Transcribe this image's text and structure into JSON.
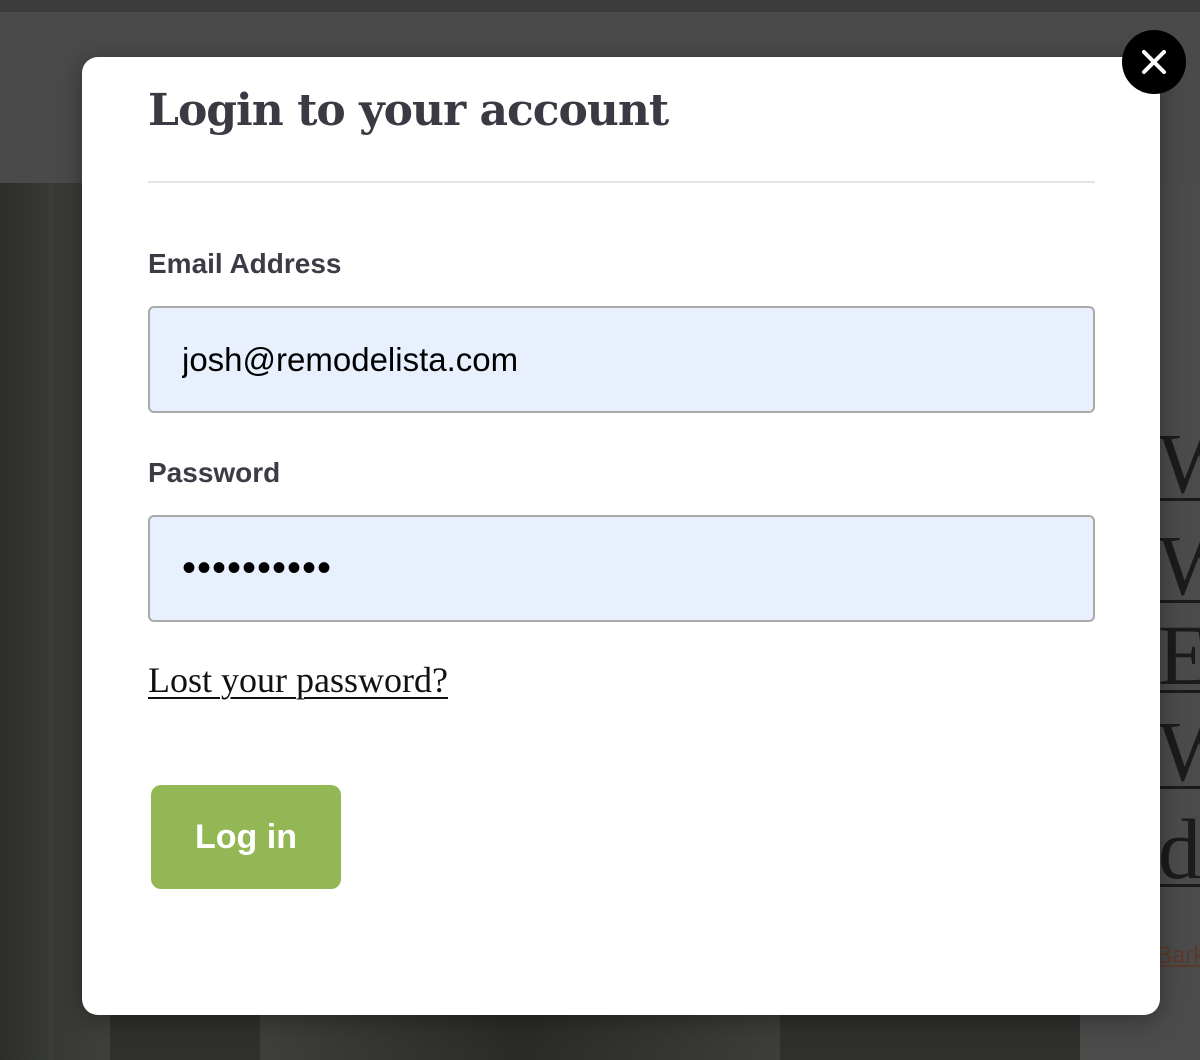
{
  "background": {
    "right_glyphs": [
      "W",
      "Wa",
      "El",
      "Wa",
      "d"
    ],
    "right_link_snippet": "Bark"
  },
  "modal": {
    "title": "Login to your account",
    "email": {
      "label": "Email Address",
      "value": "josh@remodelista.com"
    },
    "password": {
      "label": "Password",
      "masked_value": "••••••••••"
    },
    "lost_password_link": "Lost your password?",
    "login_button": "Log in",
    "close_icon": "close-icon"
  },
  "colors": {
    "login_button": "#93b755",
    "input_background": "#e8f0fe",
    "title_text": "#3a3a44",
    "close_button": "#000000"
  }
}
